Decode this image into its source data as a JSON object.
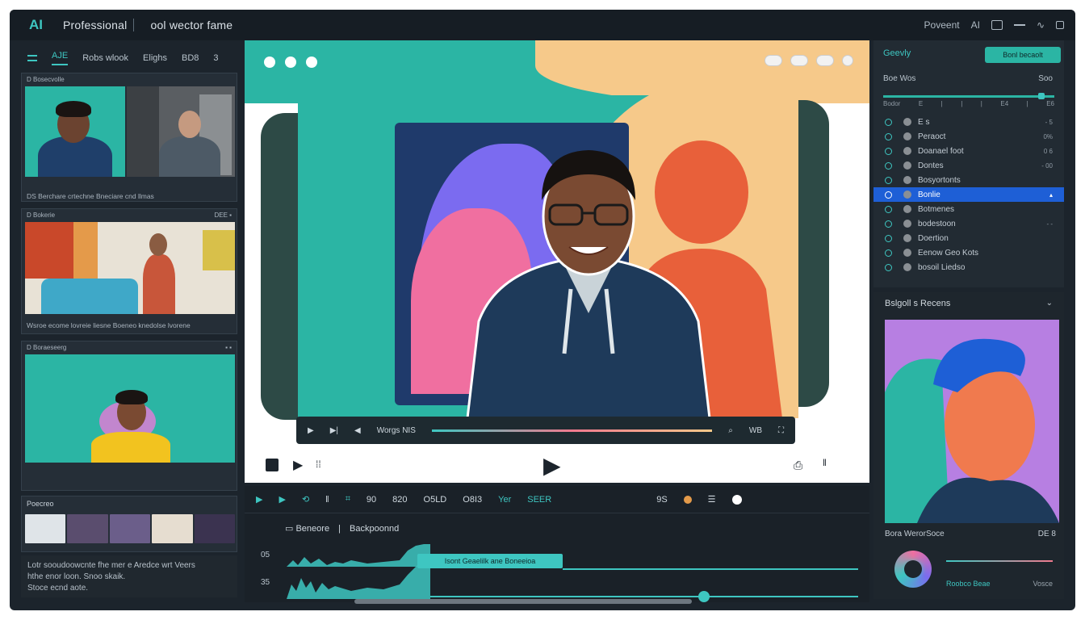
{
  "topbar": {
    "logo": "AI",
    "title": "Professional",
    "subtitle": "ool wector fame",
    "right_label": "Poveent",
    "right_ai": "AI"
  },
  "left": {
    "tabs": [
      "AJE",
      "Robs wlook",
      "Elighs",
      "BD8",
      "3"
    ],
    "cards": [
      {
        "head": "D Bosecvolle",
        "caption": "DS Berchare crtechne Bneciare cnd llmas"
      },
      {
        "head": "D Bokerie",
        "head_right": "DEE ▪",
        "caption": "Wsroe ecome lovreie liesne Boeneo knedolse lvorene"
      },
      {
        "head": "D Boraeseerg",
        "head_right": "▪ ▪",
        "caption": ""
      }
    ],
    "reel_label": "Poecreo",
    "note_lines": [
      "Lotr sooudoowcnte fhe mer e Aredce wrt Veers",
      "hthe enor loon. Snoo skaik.",
      "Stoce ecnd aote."
    ]
  },
  "preview": {
    "ctrl_time": "Worgs NIS",
    "ctrl_right": "WB"
  },
  "right": {
    "header": "Geevly",
    "button": "Bonl becaolt",
    "row_label": "Boe Wos",
    "row_value": "Soo",
    "ticks": [
      "Bodor",
      "E",
      "",
      "",
      "",
      "",
      "E4",
      "",
      "",
      "E6"
    ],
    "list": [
      {
        "label": "E s",
        "val": "- 5"
      },
      {
        "label": "Peraoct",
        "val": "0%"
      },
      {
        "label": "Doanael foot",
        "val": "0 6"
      },
      {
        "label": "Dontes",
        "val": "- 00"
      },
      {
        "label": "Bosyortonts",
        "val": ""
      },
      {
        "label": "Bonlie",
        "val": "▴",
        "selected": true
      },
      {
        "label": "Botmenes",
        "val": ""
      },
      {
        "label": "bodestoon",
        "val": "- -"
      },
      {
        "label": "Doertion",
        "val": ""
      },
      {
        "label": "Eenow Geo Kots",
        "val": ""
      },
      {
        "label": "bosoil Liedso",
        "val": ""
      }
    ],
    "panel2_head": "Bslgoll s Recens",
    "panel2_foot_left": "Bora WerorSoce",
    "panel2_foot_right": "DE 8",
    "panel2_small_1": "Roobco Beae",
    "panel2_small_2": "Vosce"
  },
  "timeline": {
    "toolbar": [
      "90",
      "820",
      "O5LD",
      "O8I3",
      "Yer",
      "SEER"
    ],
    "track_label_1": "Beneore",
    "track_label_2": "Backpoonnd",
    "track_marks": [
      "05",
      "35"
    ],
    "clip_label": "Isont Geaelilk ane Boneeioa",
    "right_label": "9S"
  },
  "colors": {
    "accent": "#3ec6c1",
    "background": "#1c242c",
    "selection": "#1e5fd6",
    "peach": "#f6c98a",
    "teal": "#2bb5a4"
  }
}
